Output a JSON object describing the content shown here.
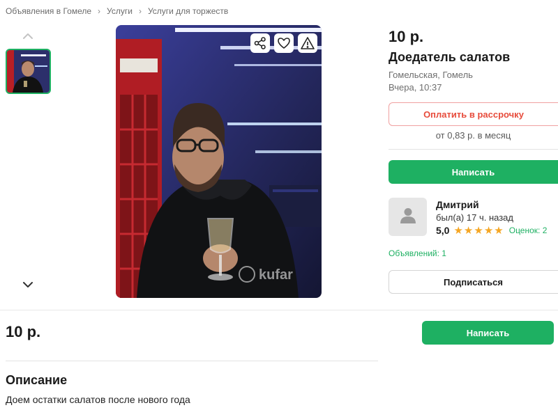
{
  "breadcrumb": [
    "Объявления в Гомеле",
    "Услуги",
    "Услуги для торжеств"
  ],
  "listing": {
    "price": "10 р.",
    "title": "Доедатель салатов",
    "location": "Гомельская, Гомель",
    "posted": "Вчера, 10:37",
    "installment_label": "Оплатить в рассрочку",
    "per_month": "от 0,83 р. в месяц",
    "write_label": "Написать",
    "photo_watermark": "kufar"
  },
  "seller": {
    "name": "Дмитрий",
    "last_seen": "был(а) 17 ч. назад",
    "rating": "5,0",
    "stars": 5,
    "reviews": "Оценок: 2",
    "ads": "Объявлений: 1",
    "subscribe_label": "Подписаться"
  },
  "description": {
    "heading": "Описание",
    "text": "Доем остатки салатов после нового года"
  },
  "icons": {
    "share": "share-icon",
    "favorite": "heart-icon",
    "report": "warning-icon",
    "up": "chevron-up-icon",
    "down": "chevron-down-icon",
    "avatar": "user-placeholder-icon"
  },
  "colors": {
    "accent": "#1eb062",
    "installment": "#e74c3c",
    "star": "#f5a623"
  }
}
